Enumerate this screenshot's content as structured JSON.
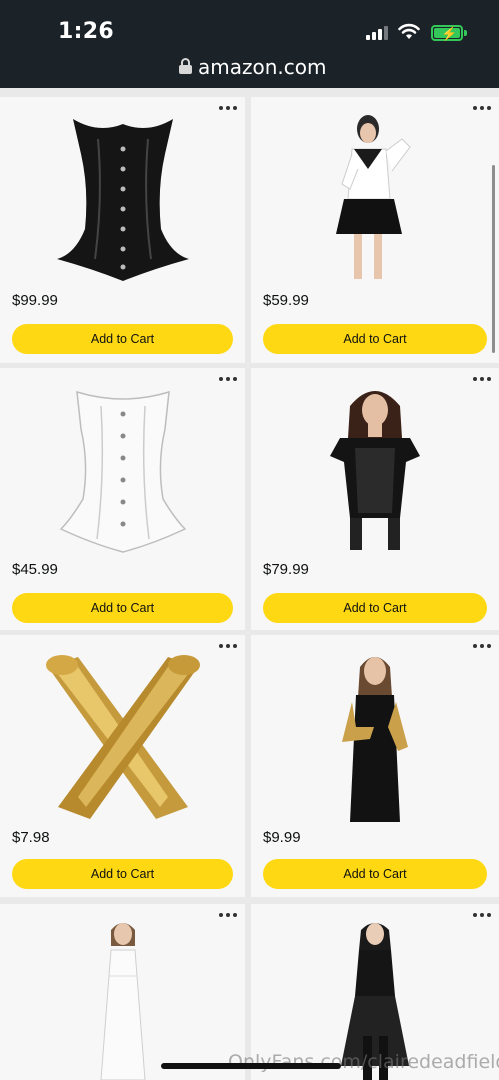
{
  "status_bar": {
    "time": "1:26"
  },
  "browser": {
    "url": "amazon.com"
  },
  "products": [
    {
      "price": "$99.99",
      "button": "Add to Cart",
      "image": "black-satin-corset"
    },
    {
      "price": "$59.99",
      "button": "Add to Cart",
      "image": "sailor-costume"
    },
    {
      "price": "$45.99",
      "button": "Add to Cart",
      "image": "white-corset"
    },
    {
      "price": "$79.99",
      "button": "Add to Cart",
      "image": "black-lace-bodysuit"
    },
    {
      "price": "$7.98",
      "button": "Add to Cart",
      "image": "gold-gloves"
    },
    {
      "price": "$9.99",
      "button": "Add to Cart",
      "image": "woman-gold-gloves-dress"
    },
    {
      "price": "",
      "button": "",
      "image": "white-lace-dress"
    },
    {
      "price": "",
      "button": "",
      "image": "black-costume"
    }
  ],
  "watermark": "OnlyFans.com/clairedeadfield",
  "colors": {
    "button": "#ffd814",
    "status_bar": "#1b2228",
    "battery": "#34c759"
  }
}
